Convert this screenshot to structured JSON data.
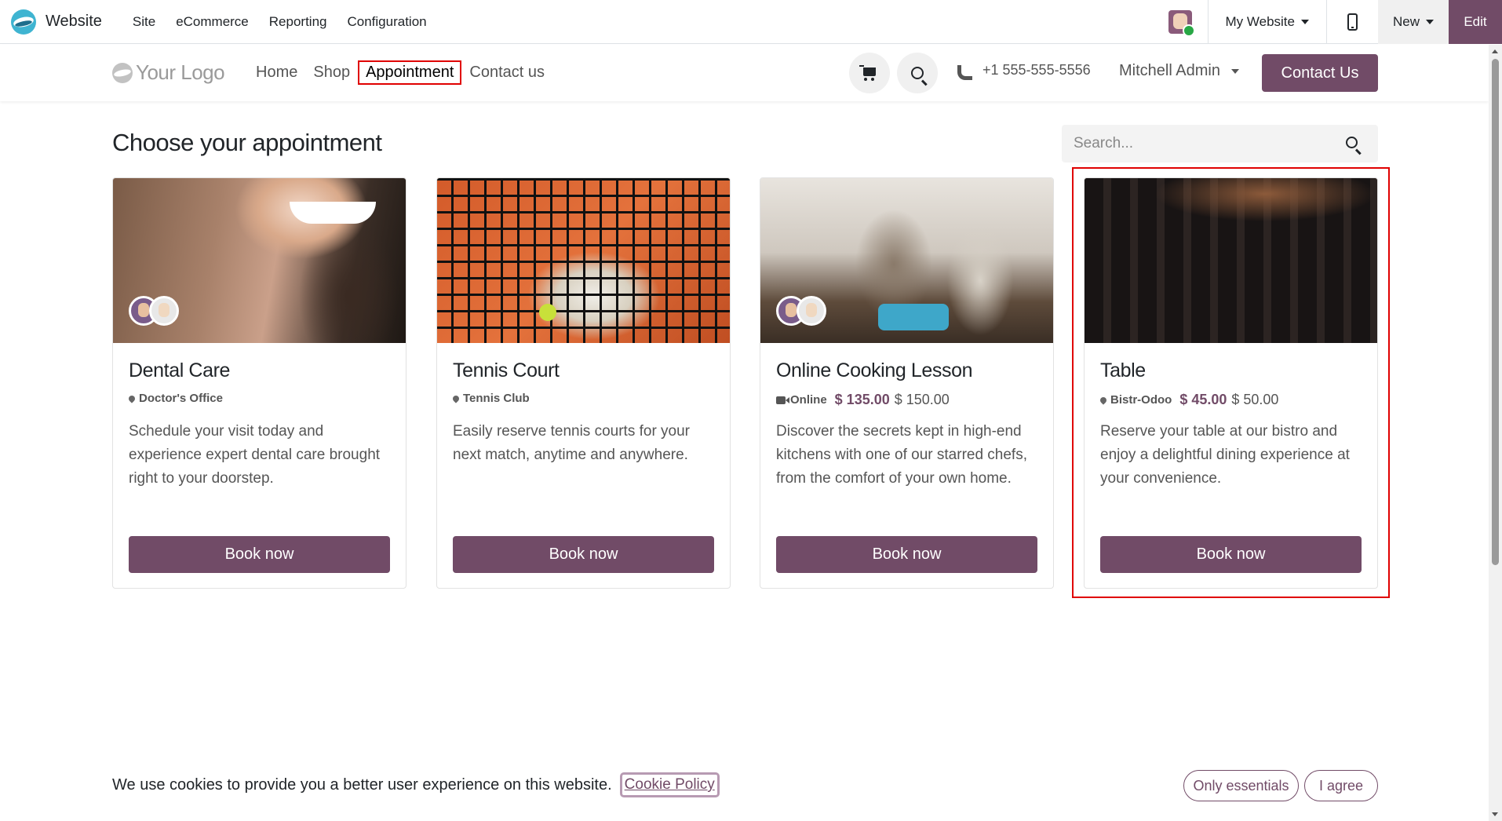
{
  "adminbar": {
    "app_name": "Website",
    "menu": [
      "Site",
      "eCommerce",
      "Reporting",
      "Configuration"
    ],
    "website_selector": "My Website",
    "new_label": "New",
    "edit_label": "Edit"
  },
  "header": {
    "logo_text": "Your Logo",
    "nav": [
      "Home",
      "Shop",
      "Appointment",
      "Contact us"
    ],
    "active_nav": "Appointment",
    "phone": "+1 555-555-5556",
    "user": "Mitchell Admin",
    "contact_button": "Contact Us"
  },
  "main": {
    "title": "Choose your appointment",
    "search_placeholder": "Search...",
    "cards": [
      {
        "title": "Dental Care",
        "location": "Doctor's Office",
        "location_icon": "pin-icon",
        "price": "",
        "price_old": "",
        "description": "Schedule your visit today and experience expert dental care brought right to your doorstep.",
        "button": "Book now"
      },
      {
        "title": "Tennis Court",
        "location": "Tennis Club",
        "location_icon": "pin-icon",
        "price": "",
        "price_old": "",
        "description": "Easily reserve tennis courts for your next match, anytime and anywhere.",
        "button": "Book now"
      },
      {
        "title": "Online Cooking Lesson",
        "location": "Online",
        "location_icon": "video-icon",
        "price": "$ 135.00",
        "price_old": "$ 150.00",
        "description": "Discover the secrets kept in high-end kitchens with one of our starred chefs, from the comfort of your own home.",
        "button": "Book now"
      },
      {
        "title": "Table",
        "location": "Bistr-Odoo",
        "location_icon": "pin-icon",
        "price": "$ 45.00",
        "price_old": "$ 50.00",
        "description": "Reserve your table at our bistro and enjoy a delightful dining experience at your convenience.",
        "button": "Book now"
      }
    ]
  },
  "cookie": {
    "text": "We use cookies to provide you a better user experience on this website.",
    "policy_link": "Cookie Policy",
    "essentials_button": "Only essentials",
    "agree_button": "I agree"
  },
  "colors": {
    "brand": "#714b67",
    "highlight": "#e00000"
  }
}
